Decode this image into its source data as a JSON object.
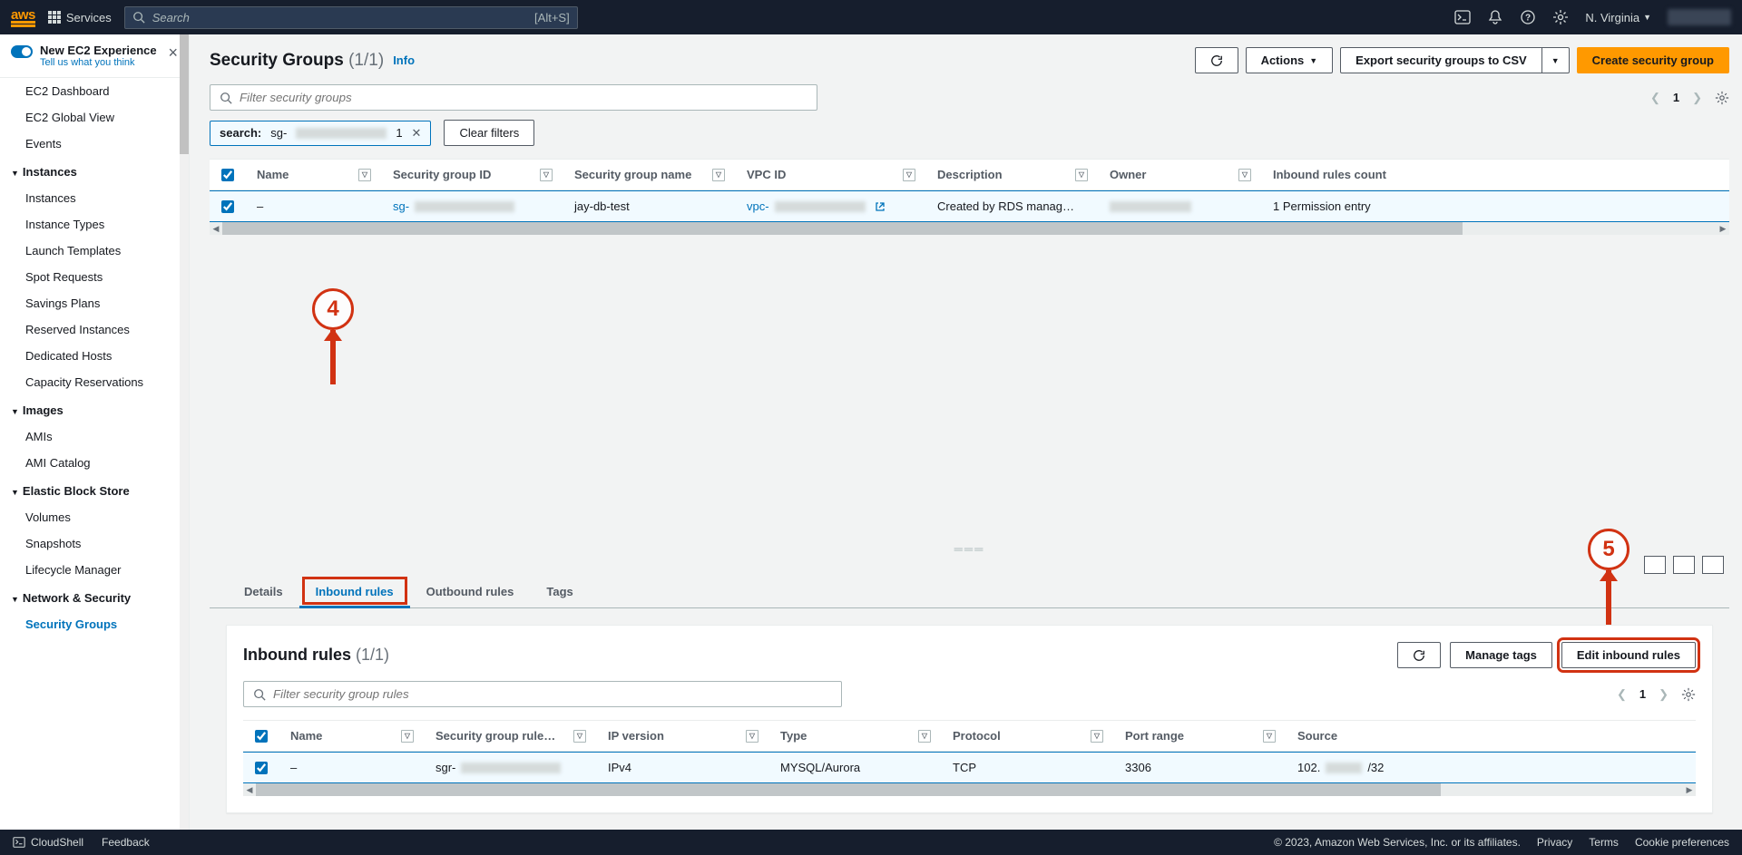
{
  "topnav": {
    "logo": "aws",
    "services": "Services",
    "search_placeholder": "Search",
    "search_kbd": "[Alt+S]",
    "region": "N. Virginia"
  },
  "sidebar": {
    "new_experience_title": "New EC2 Experience",
    "new_experience_sub": "Tell us what you think",
    "top_links": [
      "EC2 Dashboard",
      "EC2 Global View",
      "Events"
    ],
    "sections": [
      {
        "title": "Instances",
        "items": [
          "Instances",
          "Instance Types",
          "Launch Templates",
          "Spot Requests",
          "Savings Plans",
          "Reserved Instances",
          "Dedicated Hosts",
          "Capacity Reservations"
        ]
      },
      {
        "title": "Images",
        "items": [
          "AMIs",
          "AMI Catalog"
        ]
      },
      {
        "title": "Elastic Block Store",
        "items": [
          "Volumes",
          "Snapshots",
          "Lifecycle Manager"
        ]
      },
      {
        "title": "Network & Security",
        "items": [
          "Security Groups"
        ]
      }
    ],
    "active": "Security Groups"
  },
  "page": {
    "title": "Security Groups",
    "count": "(1/1)",
    "info_label": "Info",
    "actions_btn": "Actions",
    "export_btn": "Export security groups to CSV",
    "create_btn": "Create security group",
    "filter_placeholder": "Filter security groups",
    "chip_label": "search:",
    "chip_value_prefix": "sg-",
    "chip_count": "1",
    "clear_filters": "Clear filters",
    "page_num": "1"
  },
  "sg_table": {
    "headers": [
      "Name",
      "Security group ID",
      "Security group name",
      "VPC ID",
      "Description",
      "Owner",
      "Inbound rules count"
    ],
    "row": {
      "name": "–",
      "sgid_prefix": "sg-",
      "sgname": "jay-db-test",
      "vpc_prefix": "vpc-",
      "desc": "Created by RDS manag…",
      "inbound": "1 Permission entry"
    }
  },
  "detail": {
    "tabs": [
      "Details",
      "Inbound rules",
      "Outbound rules",
      "Tags"
    ],
    "active_tab": "Inbound rules",
    "panel_title": "Inbound rules",
    "panel_count": "(1/1)",
    "manage_tags": "Manage tags",
    "edit_btn": "Edit inbound rules",
    "filter_placeholder": "Filter security group rules",
    "page_num": "1",
    "headers": [
      "Name",
      "Security group rule…",
      "IP version",
      "Type",
      "Protocol",
      "Port range",
      "Source"
    ],
    "row": {
      "name": "–",
      "ruleid_prefix": "sgr-",
      "ipv": "IPv4",
      "type": "MYSQL/Aurora",
      "proto": "TCP",
      "port": "3306",
      "src_prefix": "102.",
      "src_suffix": "/32"
    }
  },
  "annotations": {
    "a4": "4",
    "a5": "5"
  },
  "footer": {
    "cloudshell": "CloudShell",
    "feedback": "Feedback",
    "copyright": "© 2023, Amazon Web Services, Inc. or its affiliates.",
    "links": [
      "Privacy",
      "Terms",
      "Cookie preferences"
    ]
  }
}
